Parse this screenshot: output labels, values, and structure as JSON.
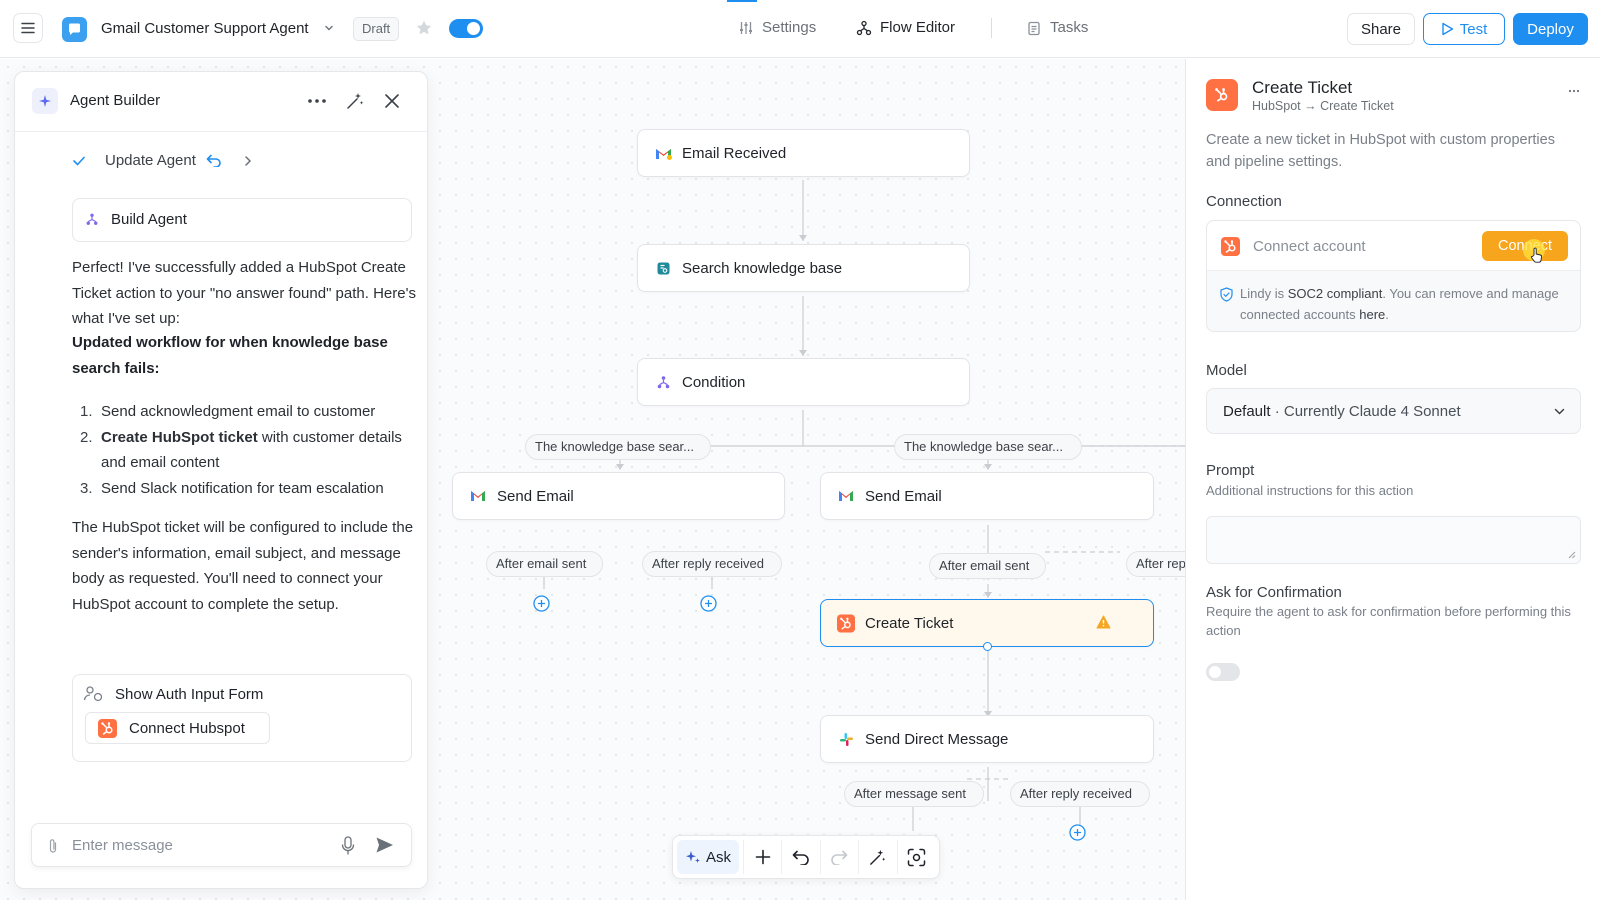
{
  "topbar": {
    "agent_name": "Gmail Customer Support Agent",
    "status": "Draft",
    "tabs": [
      {
        "label": "Settings",
        "icon": "sliders-icon"
      },
      {
        "label": "Flow Editor",
        "icon": "flow-icon"
      },
      {
        "label": "Tasks",
        "icon": "clipboard-icon"
      }
    ],
    "active_tab": "Flow Editor",
    "share_label": "Share",
    "test_label": "Test",
    "deploy_label": "Deploy"
  },
  "builder": {
    "title": "Agent Builder",
    "step_label": "Update Agent",
    "build_card_label": "Build Agent",
    "message_intro": "Perfect! I've successfully added a HubSpot Create Ticket action to your \"no answer found\" path. Here's what I've set up:",
    "message_heading": "Updated workflow for when knowledge base search fails:",
    "list_items": [
      {
        "number": "1.",
        "bold": "",
        "text": "Send acknowledgment email to customer"
      },
      {
        "number": "2.",
        "bold": "Create HubSpot ticket",
        "text": " with customer details and email content"
      },
      {
        "number": "3.",
        "bold": "",
        "text": "Send Slack notification for team escalation"
      }
    ],
    "message_outro": "The HubSpot ticket will be configured to include the sender's information, email subject, and message body as requested. You'll need to connect your HubSpot account to complete the setup.",
    "auth_card_title": "Show Auth Input Form",
    "connect_button": "Connect Hubspot",
    "input_placeholder": "Enter message"
  },
  "flow": {
    "nodes": {
      "email_received": "Email Received",
      "search_kb": "Search knowledge base",
      "condition": "Condition",
      "send_email_left": "Send Email",
      "send_email_right": "Send Email",
      "create_ticket": "Create Ticket",
      "send_dm": "Send Direct Message"
    },
    "branch_labels": {
      "left": "The knowledge base sear...",
      "right": "The knowledge base sear..."
    },
    "edge_labels": {
      "left_after_sent": "After email sent",
      "left_after_reply": "After reply received",
      "right_after_sent": "After email sent",
      "right_after_reply": "After rep",
      "dm_after_sent": "After message sent",
      "dm_after_reply": "After reply received"
    }
  },
  "toolbar": {
    "ask_label": "Ask"
  },
  "inspector": {
    "title": "Create Ticket",
    "breadcrumb": "HubSpot → Create Ticket",
    "description": "Create a new ticket in HubSpot with custom properties and pipeline settings.",
    "connection_label": "Connection",
    "connect_placeholder": "Connect account",
    "connect_button": "Connect",
    "soc_prefix": "Lindy is ",
    "soc_bold": "SOC2 compliant",
    "soc_mid": ". You can remove and manage connected accounts ",
    "soc_link": "here",
    "soc_end": ".",
    "model_label": "Model",
    "model_default": "Default",
    "model_detail": " · Currently Claude 4 Sonnet",
    "prompt_label": "Prompt",
    "prompt_sub": "Additional instructions for this action",
    "confirm_label": "Ask for Confirmation",
    "confirm_sub": "Require the agent to ask for confirmation before performing this action",
    "confirm_enabled": false
  },
  "colors": {
    "accent": "#1f8ef1",
    "hubspot": "#ff7043",
    "connect_button": "#f7a51c",
    "selected_node_bg": "#fff8ec",
    "warning": "#f5a623"
  }
}
